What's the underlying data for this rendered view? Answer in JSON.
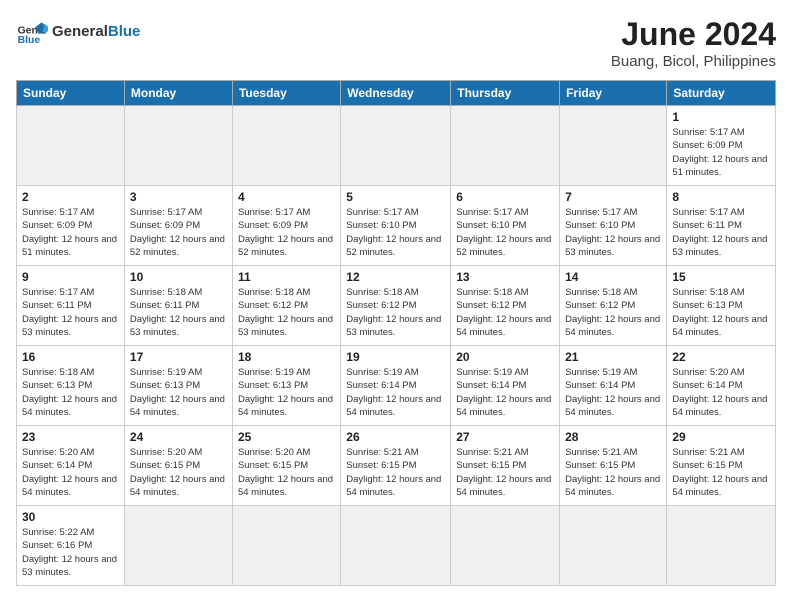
{
  "header": {
    "logo_general": "General",
    "logo_blue": "Blue",
    "title": "June 2024",
    "location": "Buang, Bicol, Philippines"
  },
  "weekdays": [
    "Sunday",
    "Monday",
    "Tuesday",
    "Wednesday",
    "Thursday",
    "Friday",
    "Saturday"
  ],
  "weeks": [
    [
      {
        "day": "",
        "info": ""
      },
      {
        "day": "",
        "info": ""
      },
      {
        "day": "",
        "info": ""
      },
      {
        "day": "",
        "info": ""
      },
      {
        "day": "",
        "info": ""
      },
      {
        "day": "",
        "info": ""
      },
      {
        "day": "1",
        "info": "Sunrise: 5:17 AM\nSunset: 6:09 PM\nDaylight: 12 hours\nand 51 minutes."
      }
    ],
    [
      {
        "day": "2",
        "info": "Sunrise: 5:17 AM\nSunset: 6:09 PM\nDaylight: 12 hours\nand 51 minutes."
      },
      {
        "day": "3",
        "info": "Sunrise: 5:17 AM\nSunset: 6:09 PM\nDaylight: 12 hours\nand 52 minutes."
      },
      {
        "day": "4",
        "info": "Sunrise: 5:17 AM\nSunset: 6:09 PM\nDaylight: 12 hours\nand 52 minutes."
      },
      {
        "day": "5",
        "info": "Sunrise: 5:17 AM\nSunset: 6:10 PM\nDaylight: 12 hours\nand 52 minutes."
      },
      {
        "day": "6",
        "info": "Sunrise: 5:17 AM\nSunset: 6:10 PM\nDaylight: 12 hours\nand 52 minutes."
      },
      {
        "day": "7",
        "info": "Sunrise: 5:17 AM\nSunset: 6:10 PM\nDaylight: 12 hours\nand 53 minutes."
      },
      {
        "day": "8",
        "info": "Sunrise: 5:17 AM\nSunset: 6:11 PM\nDaylight: 12 hours\nand 53 minutes."
      }
    ],
    [
      {
        "day": "9",
        "info": "Sunrise: 5:17 AM\nSunset: 6:11 PM\nDaylight: 12 hours\nand 53 minutes."
      },
      {
        "day": "10",
        "info": "Sunrise: 5:18 AM\nSunset: 6:11 PM\nDaylight: 12 hours\nand 53 minutes."
      },
      {
        "day": "11",
        "info": "Sunrise: 5:18 AM\nSunset: 6:12 PM\nDaylight: 12 hours\nand 53 minutes."
      },
      {
        "day": "12",
        "info": "Sunrise: 5:18 AM\nSunset: 6:12 PM\nDaylight: 12 hours\nand 53 minutes."
      },
      {
        "day": "13",
        "info": "Sunrise: 5:18 AM\nSunset: 6:12 PM\nDaylight: 12 hours\nand 54 minutes."
      },
      {
        "day": "14",
        "info": "Sunrise: 5:18 AM\nSunset: 6:12 PM\nDaylight: 12 hours\nand 54 minutes."
      },
      {
        "day": "15",
        "info": "Sunrise: 5:18 AM\nSunset: 6:13 PM\nDaylight: 12 hours\nand 54 minutes."
      }
    ],
    [
      {
        "day": "16",
        "info": "Sunrise: 5:18 AM\nSunset: 6:13 PM\nDaylight: 12 hours\nand 54 minutes."
      },
      {
        "day": "17",
        "info": "Sunrise: 5:19 AM\nSunset: 6:13 PM\nDaylight: 12 hours\nand 54 minutes."
      },
      {
        "day": "18",
        "info": "Sunrise: 5:19 AM\nSunset: 6:13 PM\nDaylight: 12 hours\nand 54 minutes."
      },
      {
        "day": "19",
        "info": "Sunrise: 5:19 AM\nSunset: 6:14 PM\nDaylight: 12 hours\nand 54 minutes."
      },
      {
        "day": "20",
        "info": "Sunrise: 5:19 AM\nSunset: 6:14 PM\nDaylight: 12 hours\nand 54 minutes."
      },
      {
        "day": "21",
        "info": "Sunrise: 5:19 AM\nSunset: 6:14 PM\nDaylight: 12 hours\nand 54 minutes."
      },
      {
        "day": "22",
        "info": "Sunrise: 5:20 AM\nSunset: 6:14 PM\nDaylight: 12 hours\nand 54 minutes."
      }
    ],
    [
      {
        "day": "23",
        "info": "Sunrise: 5:20 AM\nSunset: 6:14 PM\nDaylight: 12 hours\nand 54 minutes."
      },
      {
        "day": "24",
        "info": "Sunrise: 5:20 AM\nSunset: 6:15 PM\nDaylight: 12 hours\nand 54 minutes."
      },
      {
        "day": "25",
        "info": "Sunrise: 5:20 AM\nSunset: 6:15 PM\nDaylight: 12 hours\nand 54 minutes."
      },
      {
        "day": "26",
        "info": "Sunrise: 5:21 AM\nSunset: 6:15 PM\nDaylight: 12 hours\nand 54 minutes."
      },
      {
        "day": "27",
        "info": "Sunrise: 5:21 AM\nSunset: 6:15 PM\nDaylight: 12 hours\nand 54 minutes."
      },
      {
        "day": "28",
        "info": "Sunrise: 5:21 AM\nSunset: 6:15 PM\nDaylight: 12 hours\nand 54 minutes."
      },
      {
        "day": "29",
        "info": "Sunrise: 5:21 AM\nSunset: 6:15 PM\nDaylight: 12 hours\nand 54 minutes."
      }
    ],
    [
      {
        "day": "30",
        "info": "Sunrise: 5:22 AM\nSunset: 6:16 PM\nDaylight: 12 hours\nand 53 minutes."
      },
      {
        "day": "",
        "info": ""
      },
      {
        "day": "",
        "info": ""
      },
      {
        "day": "",
        "info": ""
      },
      {
        "day": "",
        "info": ""
      },
      {
        "day": "",
        "info": ""
      },
      {
        "day": "",
        "info": ""
      }
    ]
  ]
}
